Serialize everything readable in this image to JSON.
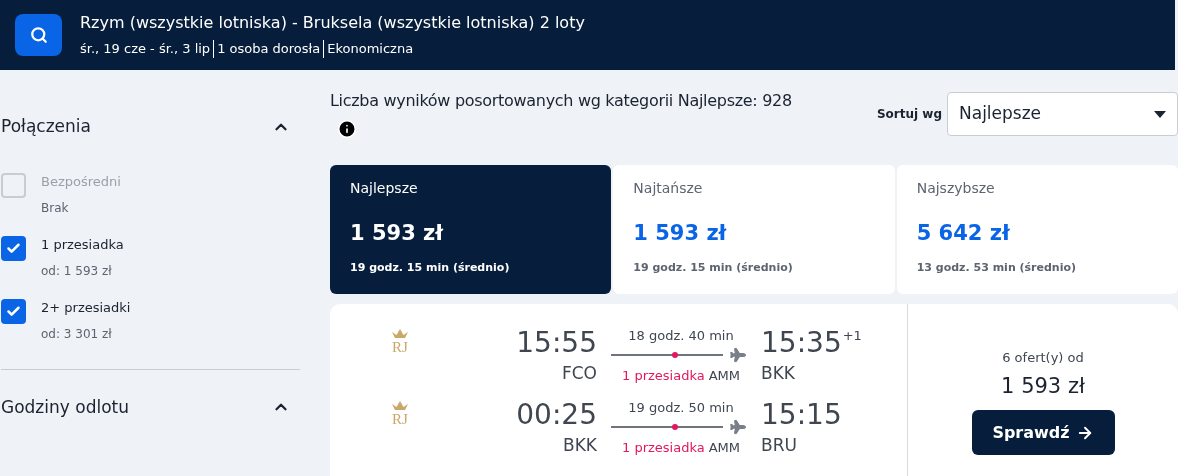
{
  "header": {
    "title": "Rzym (wszystkie lotniska) - Bruksela (wszystkie lotniska) 2 loty",
    "details": [
      "śr., 19 cze - śr., 3 lip",
      "1 osoba dorosła",
      "Ekonomiczna"
    ]
  },
  "sidebar": {
    "sections": [
      {
        "title": "Połączenia",
        "expanded": true,
        "options": [
          {
            "label": "Bezpośredni",
            "sub": "Brak",
            "checked": false,
            "disabled": true
          },
          {
            "label": "1 przesiadka",
            "sub": "od: 1 593 zł",
            "checked": true,
            "disabled": false
          },
          {
            "label": "2+ przesiadki",
            "sub": "od: 3 301 zł",
            "checked": true,
            "disabled": false
          }
        ]
      },
      {
        "title": "Godziny odlotu",
        "expanded": true
      }
    ]
  },
  "summary": "Liczba wyników posortowanych wg kategorii Najlepsze: 928",
  "sort": {
    "label": "Sortuj wg",
    "value": "Najlepsze"
  },
  "tabs": [
    {
      "label": "Najlepsze",
      "price": "1 593 zł",
      "duration": "19 godz. 15 min (średnio)",
      "selected": true
    },
    {
      "label": "Najtańsze",
      "price": "1 593 zł",
      "duration": "19 godz. 15 min (średnio)",
      "selected": false
    },
    {
      "label": "Najszybsze",
      "price": "5 642 zł",
      "duration": "13 godz. 53 min (średnio)",
      "selected": false
    }
  ],
  "result": {
    "legs": [
      {
        "logo": "RJ",
        "dep_time": "15:55",
        "dep_airport": "FCO",
        "duration": "18 godz. 40 min",
        "stops": "1 przesiadka",
        "via": "AMM",
        "arr_time": "15:35",
        "day_offset": "+1",
        "arr_airport": "BKK"
      },
      {
        "logo": "RJ",
        "dep_time": "00:25",
        "dep_airport": "BKK",
        "duration": "19 godz. 50 min",
        "stops": "1 przesiadka",
        "via": "AMM",
        "arr_time": "15:15",
        "arr_airport": "BRU"
      }
    ],
    "offers": "6 ofert(y) od",
    "price": "1 593 zł",
    "button": "Sprawdź"
  }
}
